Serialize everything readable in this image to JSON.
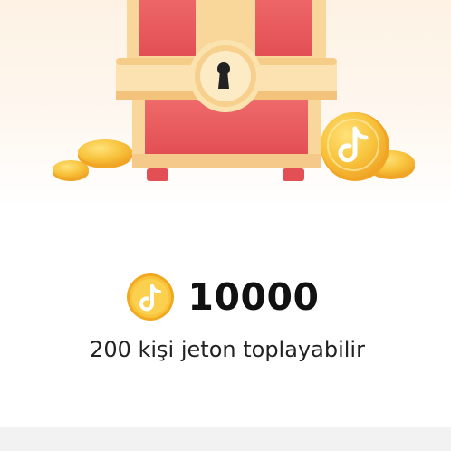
{
  "reward": {
    "amount": "10000",
    "coin_icon": "tiktok-coin-icon",
    "subtitle": "200 kişi jeton toplayabilir"
  },
  "illustration": {
    "name": "treasure-chest",
    "colors": {
      "chest_red": "#ea5a5d",
      "chest_trim": "#f9d79a",
      "coin_gold": "#f6b42a",
      "background": "#fdf2e4"
    }
  }
}
